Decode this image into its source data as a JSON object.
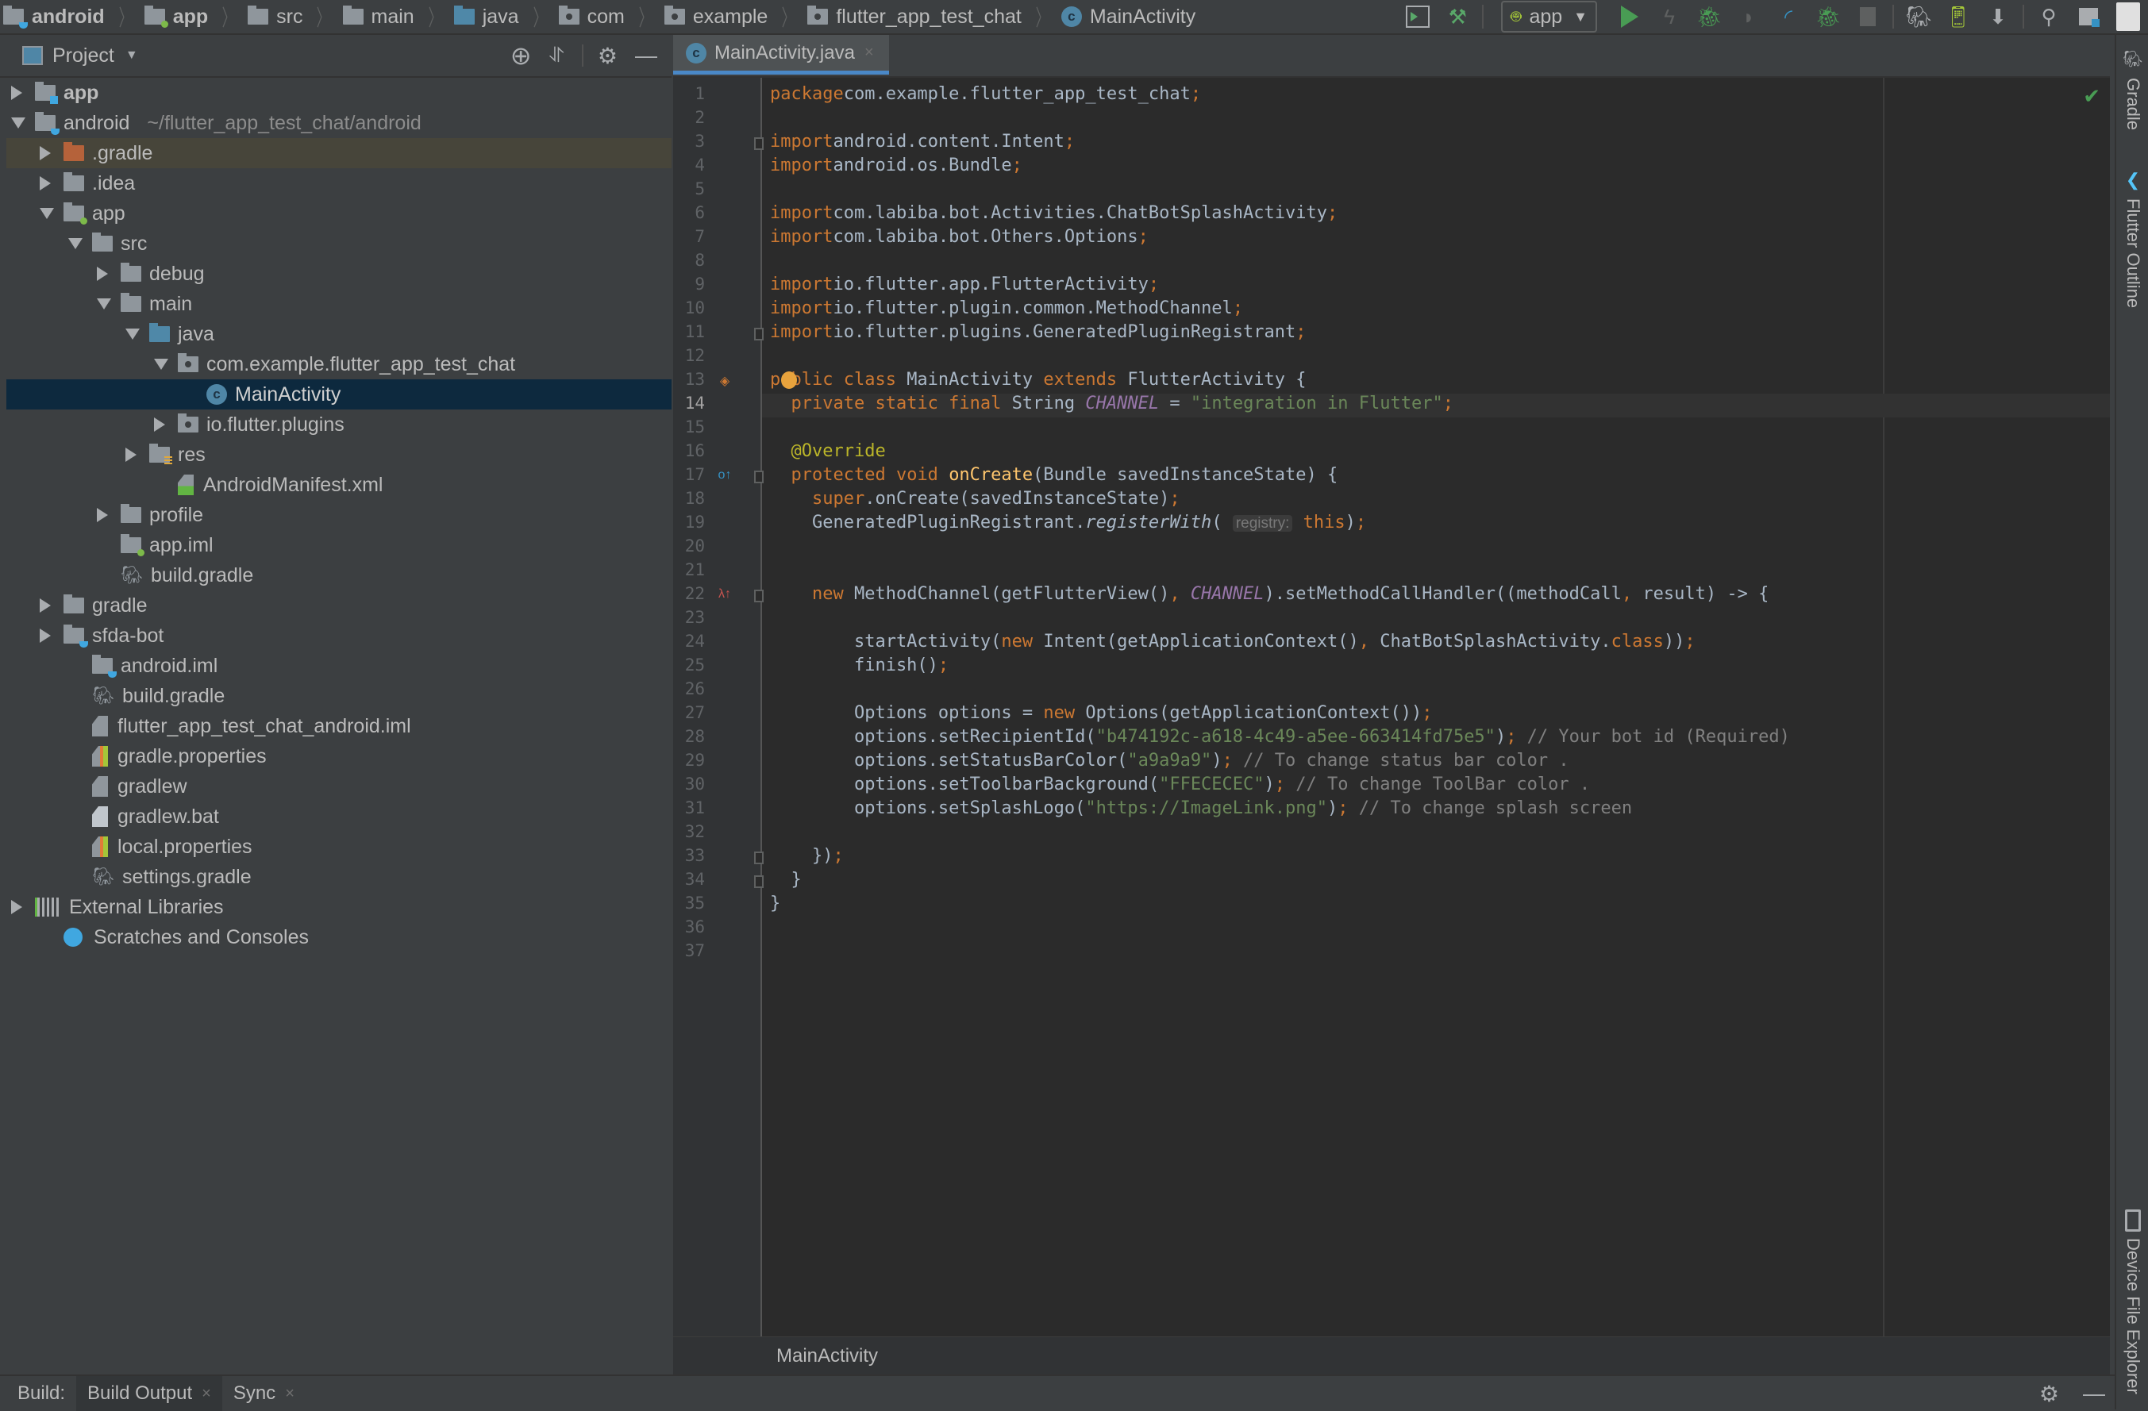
{
  "navbar": {
    "breadcrumbs": [
      {
        "label": "android",
        "icon": "module-folder-icon"
      },
      {
        "label": "app",
        "icon": "android-module-folder-icon"
      },
      {
        "label": "src",
        "icon": "folder-icon"
      },
      {
        "label": "main",
        "icon": "folder-icon"
      },
      {
        "label": "java",
        "icon": "source-folder-icon"
      },
      {
        "label": "com",
        "icon": "package-icon"
      },
      {
        "label": "example",
        "icon": "package-icon"
      },
      {
        "label": "flutter_app_test_chat",
        "icon": "package-icon"
      },
      {
        "label": "MainActivity",
        "icon": "class-icon"
      }
    ],
    "run_config": "app",
    "toolbar_icons": [
      "attach-debugger-icon",
      "build-hammer-icon",
      "run-icon",
      "apply-changes-icon",
      "debug-icon",
      "run-coverage-icon",
      "profile-icon",
      "attach-process-icon",
      "stop-icon",
      "sync-gradle-icon",
      "avd-manager-icon",
      "sdk-manager-icon",
      "search-icon",
      "project-structure-icon",
      "user-avatar-icon"
    ]
  },
  "project_panel": {
    "title": "Project",
    "tree": [
      {
        "label": "app",
        "depth": 0,
        "expand": "r",
        "icon": "module",
        "bold": true
      },
      {
        "label": "android",
        "suffix": "~/flutter_app_test_chat/android",
        "depth": 0,
        "expand": "d",
        "icon": "module-java"
      },
      {
        "label": ".gradle",
        "depth": 1,
        "expand": "r",
        "icon": "folder-orange",
        "highlight": true
      },
      {
        "label": ".idea",
        "depth": 1,
        "expand": "r",
        "icon": "folder"
      },
      {
        "label": "app",
        "depth": 1,
        "expand": "d",
        "icon": "folder-android"
      },
      {
        "label": "src",
        "depth": 2,
        "expand": "d",
        "icon": "folder"
      },
      {
        "label": "debug",
        "depth": 3,
        "expand": "r",
        "icon": "folder"
      },
      {
        "label": "main",
        "depth": 3,
        "expand": "d",
        "icon": "folder"
      },
      {
        "label": "java",
        "depth": 4,
        "expand": "d",
        "icon": "folder-blue"
      },
      {
        "label": "com.example.flutter_app_test_chat",
        "depth": 5,
        "expand": "d",
        "icon": "package"
      },
      {
        "label": "MainActivity",
        "depth": 6,
        "expand": "n",
        "icon": "class",
        "selected": true
      },
      {
        "label": "io.flutter.plugins",
        "depth": 5,
        "expand": "r",
        "icon": "package"
      },
      {
        "label": "res",
        "depth": 4,
        "expand": "r",
        "icon": "folder-res"
      },
      {
        "label": "AndroidManifest.xml",
        "depth": 5,
        "expand": "none",
        "icon": "manifest"
      },
      {
        "label": "profile",
        "depth": 3,
        "expand": "r",
        "icon": "folder"
      },
      {
        "label": "app.iml",
        "depth": 3,
        "expand": "none",
        "icon": "folder-android"
      },
      {
        "label": "build.gradle",
        "depth": 3,
        "expand": "none",
        "icon": "gradle"
      },
      {
        "label": "gradle",
        "depth": 1,
        "expand": "r",
        "icon": "folder"
      },
      {
        "label": "sfda-bot",
        "depth": 1,
        "expand": "r",
        "icon": "module-java"
      },
      {
        "label": "android.iml",
        "depth": 2,
        "expand": "none",
        "icon": "module-java",
        "shift": -1
      },
      {
        "label": "build.gradle",
        "depth": 2,
        "expand": "none",
        "icon": "gradle",
        "shift": -1
      },
      {
        "label": "flutter_app_test_chat_android.iml",
        "depth": 2,
        "expand": "none",
        "icon": "file",
        "shift": -1
      },
      {
        "label": "gradle.properties",
        "depth": 2,
        "expand": "none",
        "icon": "properties",
        "shift": -1
      },
      {
        "label": "gradlew",
        "depth": 2,
        "expand": "none",
        "icon": "file",
        "shift": -1
      },
      {
        "label": "gradlew.bat",
        "depth": 2,
        "expand": "none",
        "icon": "bat",
        "shift": -1
      },
      {
        "label": "local.properties",
        "depth": 2,
        "expand": "none",
        "icon": "properties",
        "shift": -1
      },
      {
        "label": "settings.gradle",
        "depth": 2,
        "expand": "none",
        "icon": "gradle",
        "shift": -1
      },
      {
        "label": "External Libraries",
        "depth": 0,
        "expand": "r",
        "icon": "libraries"
      },
      {
        "label": "Scratches and Consoles",
        "depth": 1,
        "expand": "none",
        "icon": "scratches",
        "shift": -1
      }
    ]
  },
  "editor": {
    "tab_label": "MainActivity.java",
    "current_line": 14,
    "lines": [
      [
        [
          "kw",
          "package"
        ],
        [
          "",
          "com.example.flutter_app_test_chat"
        ],
        [
          "kw",
          ";"
        ]
      ],
      [],
      [
        [
          "kw",
          "import"
        ],
        [
          "",
          "android.content.Intent"
        ],
        [
          "kw",
          ";"
        ]
      ],
      [
        [
          "kw",
          "import"
        ],
        [
          "",
          "android.os.Bundle"
        ],
        [
          "kw",
          ";"
        ]
      ],
      [],
      [
        [
          "kw",
          "import"
        ],
        [
          "",
          "com.labiba.bot.Activities.ChatBotSplashActivity"
        ],
        [
          "kw",
          ";"
        ]
      ],
      [
        [
          "kw",
          "import"
        ],
        [
          "",
          "com.labiba.bot.Others.Options"
        ],
        [
          "kw",
          ";"
        ]
      ],
      [],
      [
        [
          "kw",
          "import"
        ],
        [
          "",
          "io.flutter.app.FlutterActivity"
        ],
        [
          "kw",
          ";"
        ]
      ],
      [
        [
          "kw",
          "import"
        ],
        [
          "",
          "io.flutter.plugin.common.MethodChannel"
        ],
        [
          "kw",
          ";"
        ]
      ],
      [
        [
          "kw",
          "import"
        ],
        [
          "",
          "io.flutter.plugins.GeneratedPluginRegistrant"
        ],
        [
          "kw",
          ";"
        ]
      ],
      [],
      [
        [
          "kw",
          "public class "
        ],
        [
          "",
          "MainActivity "
        ],
        [
          "kw",
          "extends "
        ],
        [
          "",
          "FlutterActivity {"
        ]
      ],
      [
        [
          "",
          "  "
        ],
        [
          "kw",
          "private static final "
        ],
        [
          "",
          "String "
        ],
        [
          "fld",
          "CHANNEL"
        ],
        [
          "",
          " = "
        ],
        [
          "str",
          "\"integration in Flutter\""
        ],
        [
          "kw",
          ";"
        ]
      ],
      [],
      [
        [
          "",
          "  "
        ],
        [
          "ann",
          "@Override"
        ]
      ],
      [
        [
          "",
          "  "
        ],
        [
          "kw",
          "protected void "
        ],
        [
          "mth",
          "onCreate"
        ],
        [
          "",
          "(Bundle savedInstanceState) {"
        ]
      ],
      [
        [
          "",
          "    "
        ],
        [
          "kw",
          "super"
        ],
        [
          "",
          ".onCreate(savedInstanceState)"
        ],
        [
          "kw",
          ";"
        ]
      ],
      [
        [
          "",
          "    GeneratedPluginRegistrant."
        ],
        [
          "it",
          "registerWith"
        ],
        [
          "",
          "( "
        ],
        [
          "hint",
          "registry:"
        ],
        [
          "",
          " "
        ],
        [
          "kw",
          "this"
        ],
        [
          "",
          ")"
        ],
        [
          "kw",
          ";"
        ]
      ],
      [],
      [],
      [
        [
          "",
          "    "
        ],
        [
          "kw",
          "new "
        ],
        [
          "",
          "MethodChannel(getFlutterView()"
        ],
        [
          "kw",
          ", "
        ],
        [
          "fld",
          "CHANNEL"
        ],
        [
          "",
          ").setMethodCallHandler((methodCall"
        ],
        [
          "kw",
          ","
        ],
        [
          "",
          " result) -> {"
        ]
      ],
      [],
      [
        [
          "",
          "        startActivity("
        ],
        [
          "kw",
          "new "
        ],
        [
          "",
          "Intent(getApplicationContext()"
        ],
        [
          "kw",
          ", "
        ],
        [
          "",
          "ChatBotSplashActivity."
        ],
        [
          "kw",
          "class"
        ],
        [
          "",
          "))"
        ],
        [
          "kw",
          ";"
        ]
      ],
      [
        [
          "",
          "        finish()"
        ],
        [
          "kw",
          ";"
        ]
      ],
      [],
      [
        [
          "",
          "        Options options = "
        ],
        [
          "kw",
          "new "
        ],
        [
          "",
          "Options(getApplicationContext())"
        ],
        [
          "kw",
          ";"
        ]
      ],
      [
        [
          "",
          "        options.setRecipientId("
        ],
        [
          "str",
          "\"b474192c-a618-4c49-a5ee-663414fd75e5\""
        ],
        [
          "",
          ")"
        ],
        [
          "kw",
          ";"
        ],
        [
          "cmt",
          " // Your bot id (Required)"
        ]
      ],
      [
        [
          "",
          "        options.setStatusBarColor("
        ],
        [
          "str",
          "\"a9a9a9\""
        ],
        [
          "",
          ")"
        ],
        [
          "kw",
          ";"
        ],
        [
          "cmt",
          " // To change status bar color ."
        ]
      ],
      [
        [
          "",
          "        options.setToolbarBackground("
        ],
        [
          "str",
          "\"FFECECEC\""
        ],
        [
          "",
          ")"
        ],
        [
          "kw",
          ";"
        ],
        [
          "cmt",
          " // To change ToolBar color ."
        ]
      ],
      [
        [
          "",
          "        options.setSplashLogo("
        ],
        [
          "str",
          "\"https://ImageLink.png\""
        ],
        [
          "",
          ")"
        ],
        [
          "kw",
          ";"
        ],
        [
          "cmt",
          " // To change splash screen"
        ]
      ],
      [],
      [
        [
          "",
          "    })"
        ],
        [
          "kw",
          ";"
        ]
      ],
      [
        [
          "",
          "  }"
        ]
      ],
      [
        [
          "",
          "}"
        ]
      ],
      [],
      []
    ],
    "breadcrumb": "MainActivity"
  },
  "bottom_bar": {
    "label": "Build:",
    "tabs": [
      {
        "label": "Build Output",
        "active": true
      },
      {
        "label": "Sync",
        "active": false
      }
    ]
  },
  "right_stripe": {
    "tools": [
      "Gradle",
      "Flutter Outline",
      "Device File Explorer"
    ]
  }
}
